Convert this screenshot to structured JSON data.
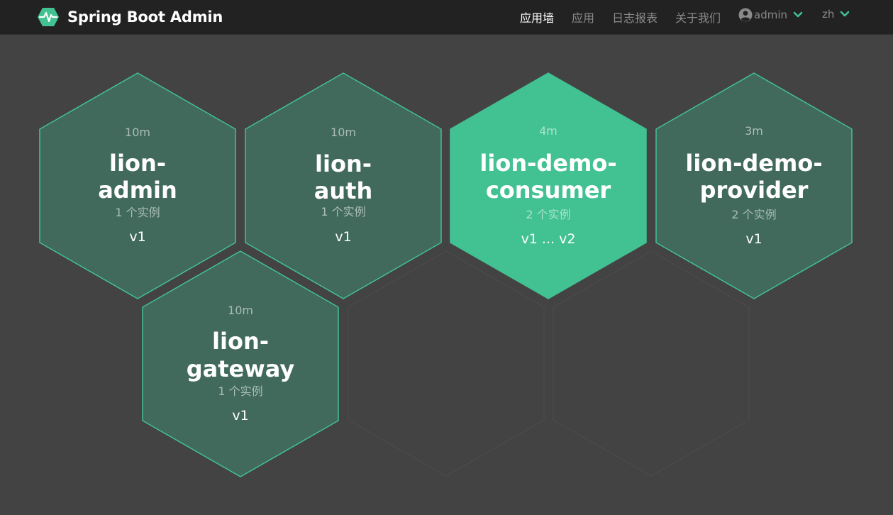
{
  "app": {
    "title": "Spring Boot Admin"
  },
  "nav": {
    "items": [
      "应用墙",
      "应用",
      "日志报表",
      "关于我们"
    ],
    "user": "admin",
    "lang": "zh"
  },
  "icons": {
    "brand": "heartbeat-hexagon-icon",
    "user": "user-circle-icon",
    "dropdown": "chevron-down-icon"
  },
  "colors": {
    "accent": "#42c193",
    "tile_fill": "#416a5c",
    "tile_stroke": "#42c193",
    "navbar_bg": "#222222",
    "page_bg": "#434343"
  },
  "applications": [
    {
      "time": "10m",
      "name_line1": "lion-",
      "name_line2": "admin",
      "instances": "1 个实例",
      "version": "v1",
      "highlighted": false
    },
    {
      "time": "10m",
      "name_line1": "lion-",
      "name_line2": "auth",
      "instances": "1 个实例",
      "version": "v1",
      "highlighted": false
    },
    {
      "time": "4m",
      "name_line1": "lion-demo-",
      "name_line2": "consumer",
      "instances": "2 个实例",
      "version": "v1 ... v2",
      "highlighted": true
    },
    {
      "time": "3m",
      "name_line1": "lion-demo-",
      "name_line2": "provider",
      "instances": "2 个实例",
      "version": "v1",
      "highlighted": false
    },
    {
      "time": "10m",
      "name_line1": "lion-",
      "name_line2": "gateway",
      "instances": "1 个实例",
      "version": "v1",
      "highlighted": false
    }
  ]
}
